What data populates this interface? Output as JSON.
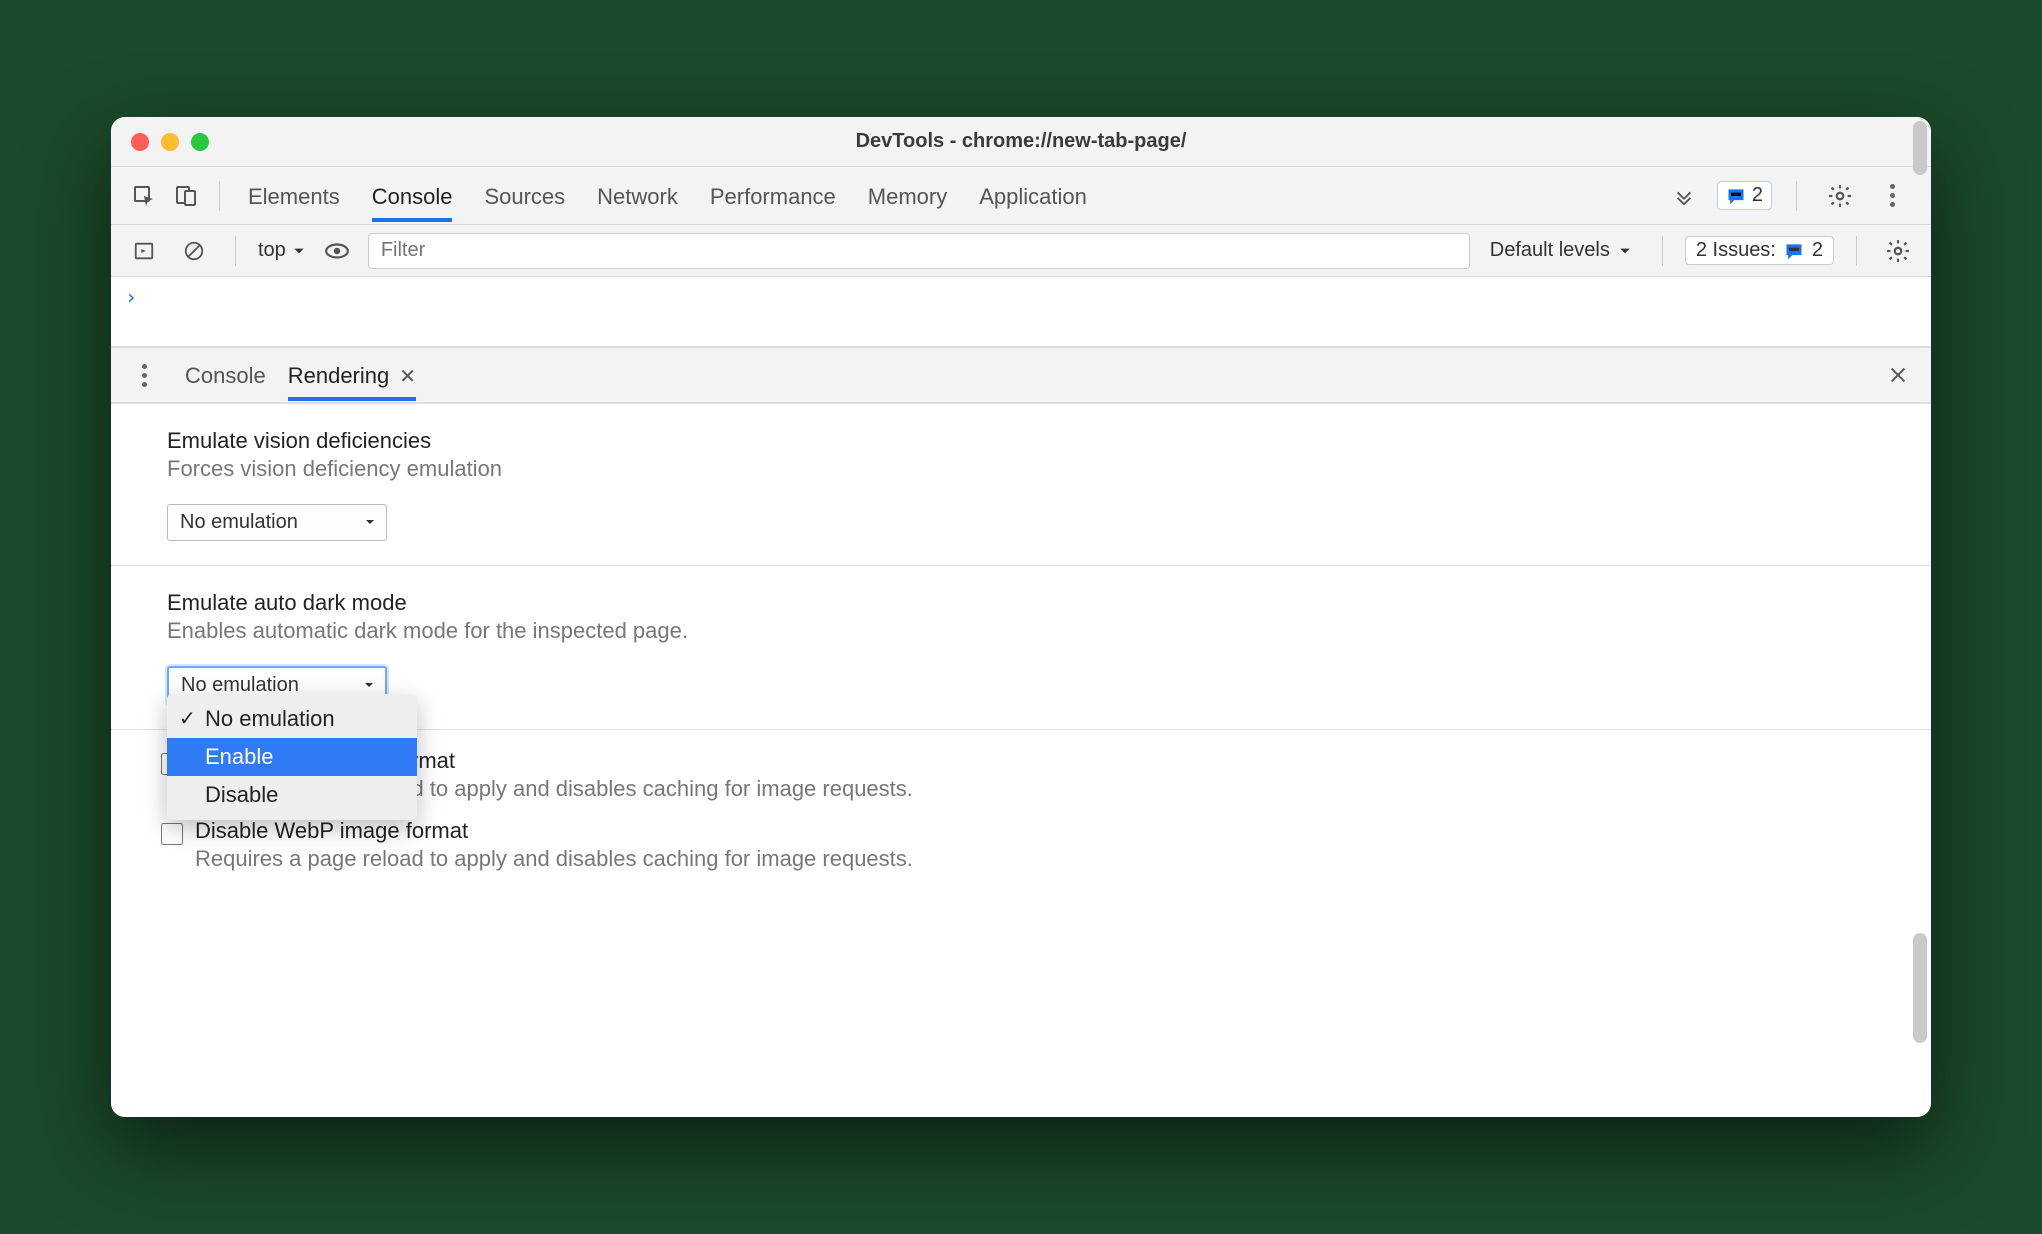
{
  "window": {
    "title": "DevTools - chrome://new-tab-page/"
  },
  "mainTabs": {
    "items": [
      "Elements",
      "Console",
      "Sources",
      "Network",
      "Performance",
      "Memory",
      "Application"
    ],
    "activeIndex": 1,
    "badgeCount": "2"
  },
  "consoleToolbar": {
    "context": "top",
    "filterPlaceholder": "Filter",
    "levels": "Default levels",
    "issuesLabel": "2 Issues:",
    "issuesCount": "2"
  },
  "consoleBody": {
    "prompt": "›"
  },
  "drawer": {
    "tabs": [
      "Console",
      "Rendering"
    ],
    "activeIndex": 1
  },
  "rendering": {
    "visionDef": {
      "title": "Emulate vision deficiencies",
      "desc": "Forces vision deficiency emulation",
      "selectValue": "No emulation"
    },
    "autoDark": {
      "title": "Emulate auto dark mode",
      "desc": "Enables automatic dark mode for the inspected page.",
      "selectValue": "No emulation",
      "options": [
        "No emulation",
        "Enable",
        "Disable"
      ],
      "selectedIndex": 0,
      "hoverIndex": 1
    },
    "avif": {
      "title": "Disable AVIF image format",
      "desc": "Requires a page reload to apply and disables caching for image requests."
    },
    "webp": {
      "title": "Disable WebP image format",
      "desc": "Requires a page reload to apply and disables caching for image requests."
    }
  }
}
